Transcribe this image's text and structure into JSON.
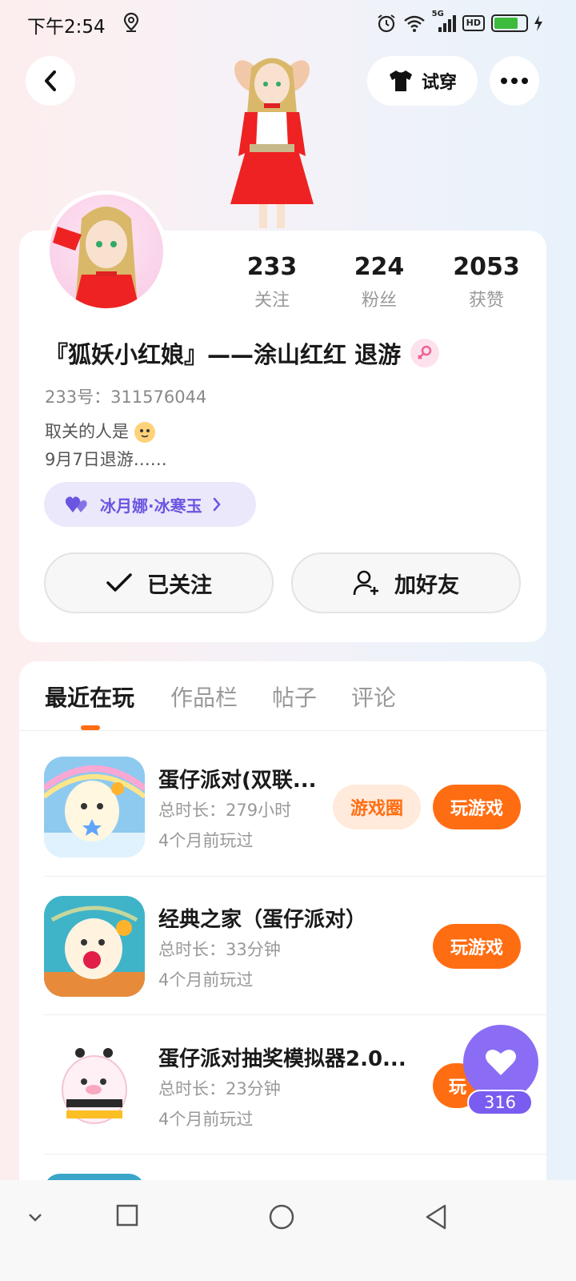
{
  "status_bar": {
    "time": "下午2:54",
    "network": "5G",
    "hd": "HD",
    "battery_level": 0.75,
    "battery_color": "#3dbb3d"
  },
  "header": {
    "back_icon": "chevron-left-icon",
    "try_on_label": "试穿",
    "try_on_icon": "tshirt-icon",
    "more_icon": "more-dots-icon"
  },
  "profile": {
    "stats": [
      {
        "value": "233",
        "label": "关注"
      },
      {
        "value": "224",
        "label": "粉丝"
      },
      {
        "value": "2053",
        "label": "获赞"
      }
    ],
    "username": "『狐妖小红娘』——涂山红红 退游",
    "gender_icon": "female-icon",
    "uid": "233号：311576044",
    "bio_line1": "取关的人是",
    "bio_line2": "9月7日退游……",
    "cp_tag": "冰月娜·冰寒玉",
    "follow_label": "已关注",
    "add_friend_label": "加好友"
  },
  "tabs": [
    {
      "label": "最近在玩",
      "active": true
    },
    {
      "label": "作品栏",
      "active": false
    },
    {
      "label": "帖子",
      "active": false
    },
    {
      "label": "评论",
      "active": false
    }
  ],
  "games": [
    {
      "name": "蛋仔派对(双联...",
      "duration": "总时长：279小时",
      "last_played": "4个月前玩过",
      "circle_label": "游戏圈",
      "play_label": "玩游戏"
    },
    {
      "name": "经典之家（蛋仔派对）",
      "duration": "总时长：33分钟",
      "last_played": "4个月前玩过",
      "play_label": "玩游戏"
    },
    {
      "name": "蛋仔派对抽奖模拟器2.0...",
      "duration": "总时长：23分钟",
      "last_played": "4个月前玩过",
      "play_label": "玩"
    }
  ],
  "like_fab": {
    "count": "316",
    "color": "#8b6cf5"
  },
  "accent_color": "#ff6d12"
}
